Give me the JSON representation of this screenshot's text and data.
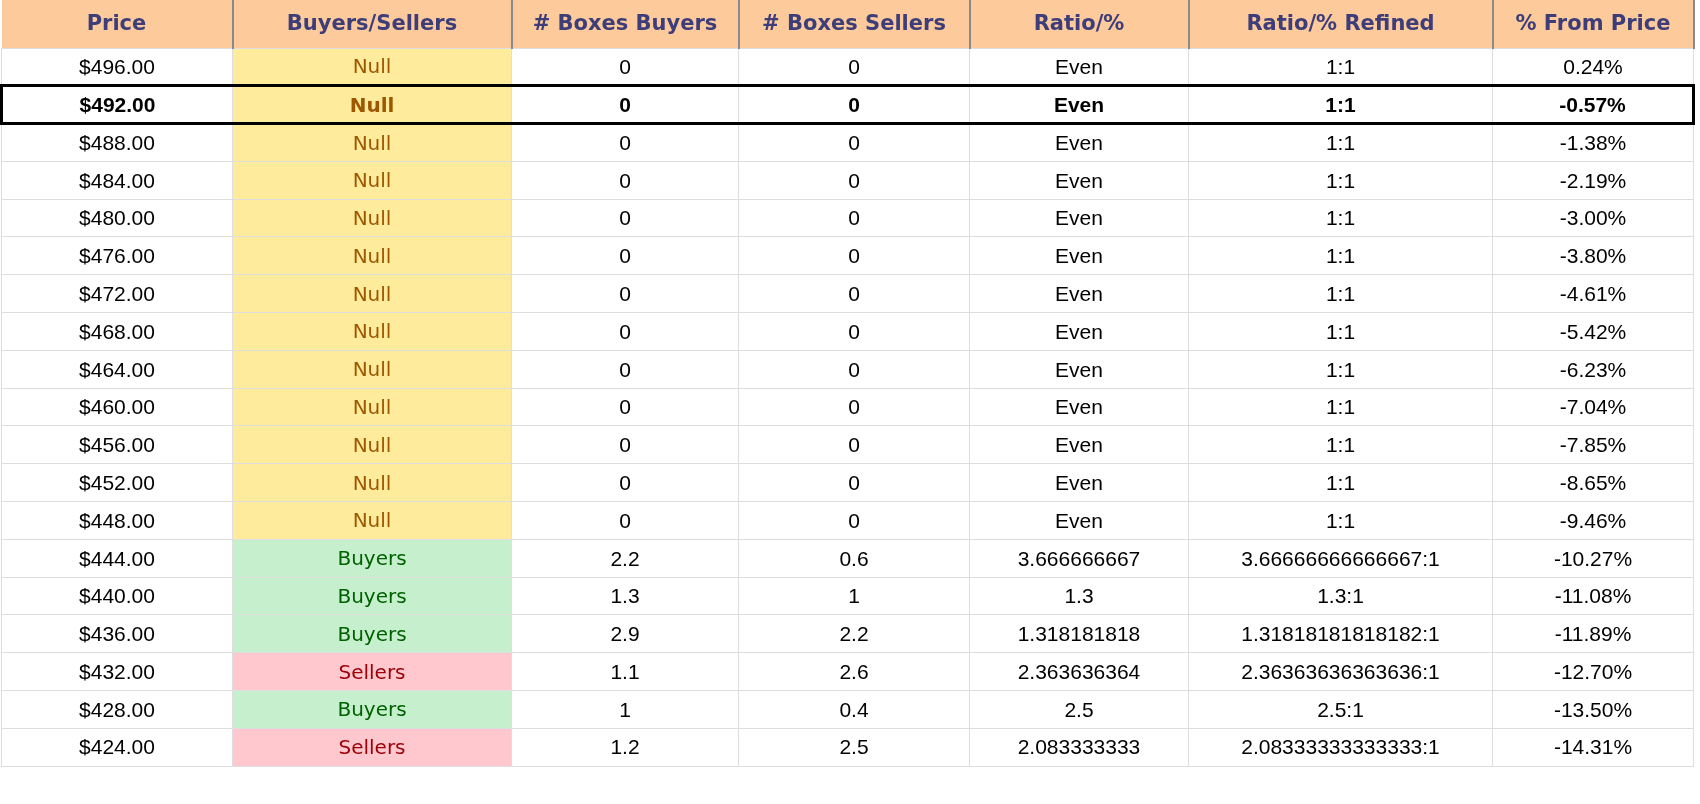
{
  "table": {
    "columns": [
      "Price",
      "Buyers/Sellers",
      "# Boxes Buyers",
      "# Boxes Sellers",
      "Ratio/%",
      "Ratio/% Refined",
      "% From Price"
    ],
    "rows": [
      {
        "price": "$496.00",
        "side": "Null",
        "kind": "null",
        "boxes_buyers": "0",
        "boxes_sellers": "0",
        "ratio": "Even",
        "ratio_refined": "1:1",
        "from_price": "0.24%",
        "selected": false
      },
      {
        "price": "$492.00",
        "side": "Null",
        "kind": "null",
        "boxes_buyers": "0",
        "boxes_sellers": "0",
        "ratio": "Even",
        "ratio_refined": "1:1",
        "from_price": "-0.57%",
        "selected": true
      },
      {
        "price": "$488.00",
        "side": "Null",
        "kind": "null",
        "boxes_buyers": "0",
        "boxes_sellers": "0",
        "ratio": "Even",
        "ratio_refined": "1:1",
        "from_price": "-1.38%",
        "selected": false
      },
      {
        "price": "$484.00",
        "side": "Null",
        "kind": "null",
        "boxes_buyers": "0",
        "boxes_sellers": "0",
        "ratio": "Even",
        "ratio_refined": "1:1",
        "from_price": "-2.19%",
        "selected": false
      },
      {
        "price": "$480.00",
        "side": "Null",
        "kind": "null",
        "boxes_buyers": "0",
        "boxes_sellers": "0",
        "ratio": "Even",
        "ratio_refined": "1:1",
        "from_price": "-3.00%",
        "selected": false
      },
      {
        "price": "$476.00",
        "side": "Null",
        "kind": "null",
        "boxes_buyers": "0",
        "boxes_sellers": "0",
        "ratio": "Even",
        "ratio_refined": "1:1",
        "from_price": "-3.80%",
        "selected": false
      },
      {
        "price": "$472.00",
        "side": "Null",
        "kind": "null",
        "boxes_buyers": "0",
        "boxes_sellers": "0",
        "ratio": "Even",
        "ratio_refined": "1:1",
        "from_price": "-4.61%",
        "selected": false
      },
      {
        "price": "$468.00",
        "side": "Null",
        "kind": "null",
        "boxes_buyers": "0",
        "boxes_sellers": "0",
        "ratio": "Even",
        "ratio_refined": "1:1",
        "from_price": "-5.42%",
        "selected": false
      },
      {
        "price": "$464.00",
        "side": "Null",
        "kind": "null",
        "boxes_buyers": "0",
        "boxes_sellers": "0",
        "ratio": "Even",
        "ratio_refined": "1:1",
        "from_price": "-6.23%",
        "selected": false
      },
      {
        "price": "$460.00",
        "side": "Null",
        "kind": "null",
        "boxes_buyers": "0",
        "boxes_sellers": "0",
        "ratio": "Even",
        "ratio_refined": "1:1",
        "from_price": "-7.04%",
        "selected": false
      },
      {
        "price": "$456.00",
        "side": "Null",
        "kind": "null",
        "boxes_buyers": "0",
        "boxes_sellers": "0",
        "ratio": "Even",
        "ratio_refined": "1:1",
        "from_price": "-7.85%",
        "selected": false
      },
      {
        "price": "$452.00",
        "side": "Null",
        "kind": "null",
        "boxes_buyers": "0",
        "boxes_sellers": "0",
        "ratio": "Even",
        "ratio_refined": "1:1",
        "from_price": "-8.65%",
        "selected": false
      },
      {
        "price": "$448.00",
        "side": "Null",
        "kind": "null",
        "boxes_buyers": "0",
        "boxes_sellers": "0",
        "ratio": "Even",
        "ratio_refined": "1:1",
        "from_price": "-9.46%",
        "selected": false
      },
      {
        "price": "$444.00",
        "side": "Buyers",
        "kind": "buyers",
        "boxes_buyers": "2.2",
        "boxes_sellers": "0.6",
        "ratio": "3.666666667",
        "ratio_refined": "3.66666666666667:1",
        "from_price": "-10.27%",
        "selected": false
      },
      {
        "price": "$440.00",
        "side": "Buyers",
        "kind": "buyers",
        "boxes_buyers": "1.3",
        "boxes_sellers": "1",
        "ratio": "1.3",
        "ratio_refined": "1.3:1",
        "from_price": "-11.08%",
        "selected": false
      },
      {
        "price": "$436.00",
        "side": "Buyers",
        "kind": "buyers",
        "boxes_buyers": "2.9",
        "boxes_sellers": "2.2",
        "ratio": "1.318181818",
        "ratio_refined": "1.31818181818182:1",
        "from_price": "-11.89%",
        "selected": false
      },
      {
        "price": "$432.00",
        "side": "Sellers",
        "kind": "sellers",
        "boxes_buyers": "1.1",
        "boxes_sellers": "2.6",
        "ratio": "2.363636364",
        "ratio_refined": "2.36363636363636:1",
        "from_price": "-12.70%",
        "selected": false
      },
      {
        "price": "$428.00",
        "side": "Buyers",
        "kind": "buyers",
        "boxes_buyers": "1",
        "boxes_sellers": "0.4",
        "ratio": "2.5",
        "ratio_refined": "2.5:1",
        "from_price": "-13.50%",
        "selected": false
      },
      {
        "price": "$424.00",
        "side": "Sellers",
        "kind": "sellers",
        "boxes_buyers": "1.2",
        "boxes_sellers": "2.5",
        "ratio": "2.083333333",
        "ratio_refined": "2.08333333333333:1",
        "from_price": "-14.31%",
        "selected": false
      }
    ]
  }
}
